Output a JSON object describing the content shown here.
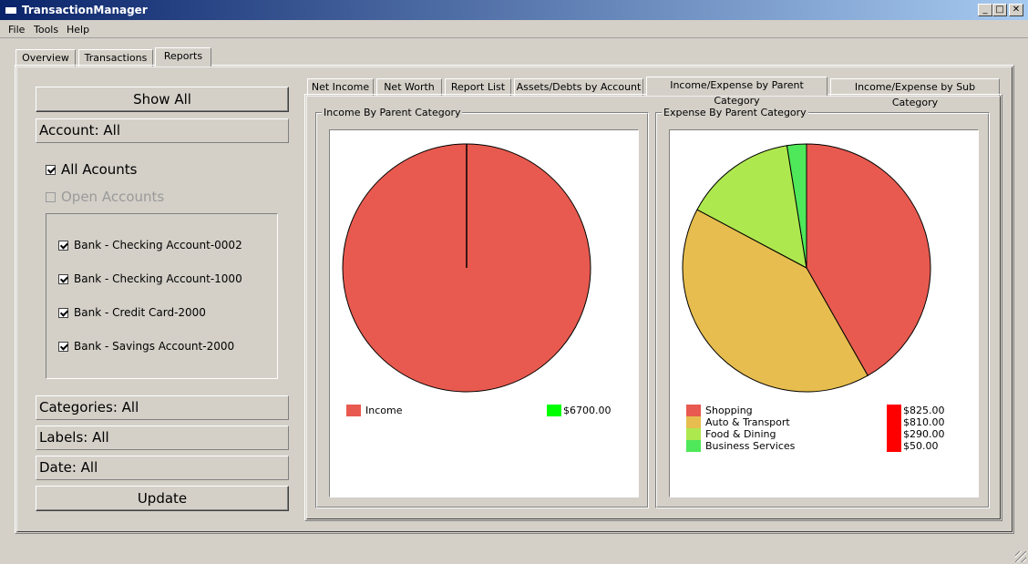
{
  "window": {
    "title": "TransactionManager",
    "minimize_glyph": "_",
    "maximize_glyph": "□",
    "close_glyph": "✕"
  },
  "menu": [
    "File",
    "Tools",
    "Help"
  ],
  "main_tabs": [
    {
      "label": "Overview",
      "active": false
    },
    {
      "label": "Transactions",
      "active": false
    },
    {
      "label": "Reports",
      "active": true
    }
  ],
  "filters": {
    "show_all_label": "Show All",
    "account_label": "Account: All",
    "all_accounts_label": "All Acounts",
    "all_accounts_checked": true,
    "open_accounts_label": "Open Accounts",
    "open_accounts_checked": false,
    "accounts": [
      {
        "label": "Bank - Checking Account-0002",
        "checked": true
      },
      {
        "label": "Bank - Checking Account-1000",
        "checked": true
      },
      {
        "label": "Bank - Credit Card-2000",
        "checked": true
      },
      {
        "label": "Bank - Savings Account-2000",
        "checked": true
      }
    ],
    "categories_label": "Categories: All",
    "labels_label": "Labels: All",
    "date_label": "Date: All",
    "update_label": "Update"
  },
  "report_tabs": [
    {
      "label": "Net Income",
      "active": false
    },
    {
      "label": "Net Worth",
      "active": false
    },
    {
      "label": "Report List",
      "active": false
    },
    {
      "label": "Assets/Debts by Account",
      "active": false
    },
    {
      "label": "Income/Expense by Parent Category",
      "active": true
    },
    {
      "label": "Income/Expense by Sub Category",
      "active": false
    }
  ],
  "colors": {
    "income_slice": "#e85a4f",
    "value_swatch_income": "#00ff00",
    "value_swatch_expense": "#ff0000"
  },
  "chart_data": [
    {
      "type": "pie",
      "title": "Income By Parent Category",
      "categories": [
        "Income"
      ],
      "values": [
        6700.0
      ],
      "value_labels": [
        "$6700.00"
      ],
      "colors": [
        "#e85a4f"
      ]
    },
    {
      "type": "pie",
      "title": "Expense By Parent Category",
      "categories": [
        "Shopping",
        "Auto & Transport",
        "Food & Dining",
        "Business Services"
      ],
      "values": [
        825.0,
        810.0,
        290.0,
        50.0
      ],
      "value_labels": [
        "$825.00",
        "$810.00",
        "$290.00",
        "$50.00"
      ],
      "colors": [
        "#e85a4f",
        "#e6bd4e",
        "#aee84f",
        "#4fe85a"
      ]
    }
  ]
}
